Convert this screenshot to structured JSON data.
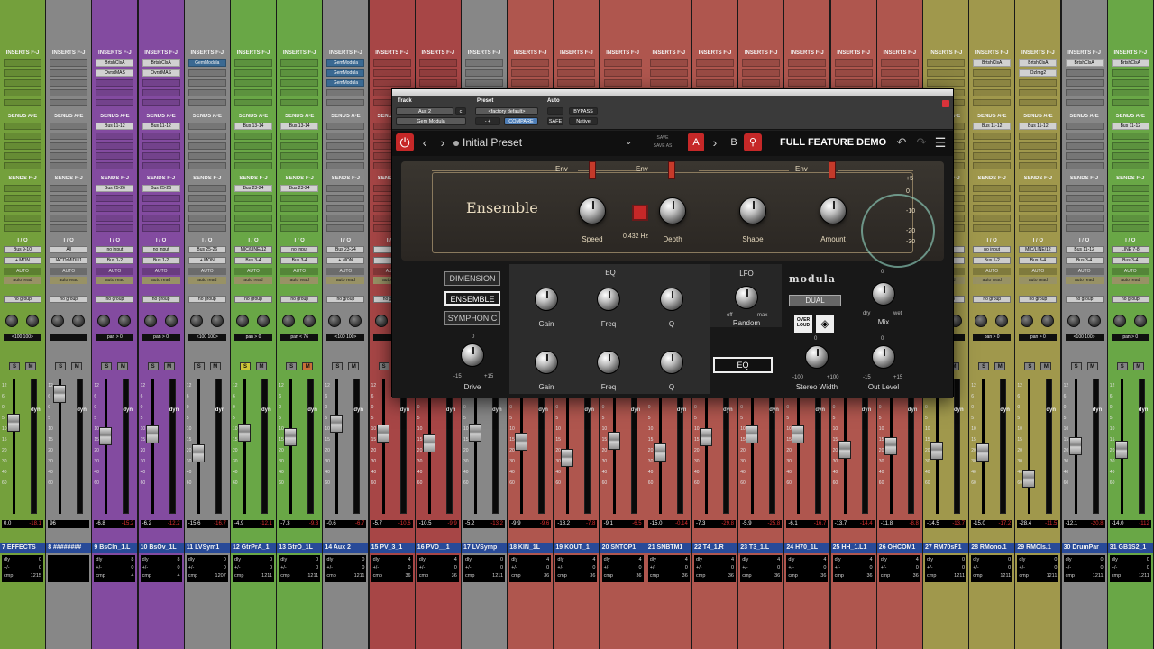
{
  "mixer": {
    "labels": {
      "inserts": "INSERTS F-J",
      "sends_ae": "SENDS A-E",
      "sends_fj": "SENDS F-J",
      "io": "I / O",
      "auto": "AUTO",
      "auto_read": "auto read",
      "group": "no group",
      "mon": "+ MON",
      "dyn": "dyn"
    },
    "strips": [
      {
        "name": "7 EFFECTS",
        "color": "#7aa83f",
        "io_in": "Bus 9-10",
        "io_out": "+ MON",
        "pan": "<100  100>",
        "vol": "0.0",
        "peak": "-18.1",
        "inserts": [],
        "sends": [],
        "sends_b": [],
        "dly": [
          "dly",
          "0"
        ],
        "pm": [
          "+/-",
          "0"
        ],
        "cmp": [
          "cmp",
          "1215"
        ],
        "mute": false,
        "solo": false
      },
      {
        "name": "8 ########",
        "color": "#8e8e8e",
        "io_in": "All",
        "io_out": "IACDrMIDI11",
        "pan": "",
        "vol": "96",
        "peak": "",
        "inserts": [],
        "sends": [],
        "sends_b": [],
        "dly": [
          "",
          ""
        ],
        "pm": [
          "",
          ""
        ],
        "cmp": [
          "",
          ""
        ],
        "mute": false,
        "solo": false
      },
      {
        "name": "9 BsCln_1.L",
        "color": "#8a4fa8",
        "io_in": "no input",
        "io_out": "Bus 1-2",
        "pan": "pan  > 0",
        "vol": "-6.8",
        "peak": "-15.2",
        "inserts": [
          "BrtshClsA",
          "OvrstMAS"
        ],
        "sends": [
          "Bus 11-12"
        ],
        "sends_b": [
          "Bus 25-26"
        ],
        "dly": [
          "dly",
          "8"
        ],
        "pm": [
          "+/-",
          "0"
        ],
        "cmp": [
          "cmp",
          "4"
        ],
        "mute": false,
        "solo": false
      },
      {
        "name": "10 BsOv_1L",
        "color": "#8a4fa8",
        "io_in": "no input",
        "io_out": "Bus 1-2",
        "pan": "pan  > 0",
        "vol": "-6.2",
        "peak": "-12.2",
        "inserts": [
          "BrtshClsA",
          "OvrstMAS"
        ],
        "sends": [
          "Bus 11-12"
        ],
        "sends_b": [
          "Bus 25-26"
        ],
        "dly": [
          "dly",
          "8"
        ],
        "pm": [
          "+/-",
          "0"
        ],
        "cmp": [
          "cmp",
          "4"
        ],
        "mute": false,
        "solo": false
      },
      {
        "name": "11 LVSym1",
        "color": "#8e8e8e",
        "io_in": "Bus 25-26",
        "io_out": "+ MON",
        "pan": "<100  100>",
        "vol": "-15.6",
        "peak": "-16.7",
        "inserts": [
          "GemModula"
        ],
        "sends": [],
        "sends_b": [],
        "dly": [
          "dly",
          "0"
        ],
        "pm": [
          "+/-",
          "0"
        ],
        "cmp": [
          "cmp",
          "1207"
        ],
        "mute": false,
        "solo": false
      },
      {
        "name": "12 GtrPrA_1",
        "color": "#6fb04a",
        "io_in": "MIC/LINE/12",
        "io_out": "Bus 3-4",
        "pan": "pan  > 0",
        "vol": "-4.9",
        "peak": "-12.1",
        "inserts": [],
        "sends": [
          "Bus 13-14"
        ],
        "sends_b": [
          "Bus 23-24"
        ],
        "dly": [
          "dly",
          "0"
        ],
        "pm": [
          "+/-",
          "0"
        ],
        "cmp": [
          "cmp",
          "1211"
        ],
        "mute": false,
        "solo": true
      },
      {
        "name": "13 GtrO_1L",
        "color": "#6fb04a",
        "io_in": "no input",
        "io_out": "Bus 3-4",
        "pan": "pan  < 76",
        "vol": "-7.3",
        "peak": "-9.3",
        "inserts": [],
        "sends": [
          "Bus 13-14"
        ],
        "sends_b": [
          "Bus 23-24"
        ],
        "dly": [
          "dly",
          "0"
        ],
        "pm": [
          "+/-",
          "0"
        ],
        "cmp": [
          "cmp",
          "1211"
        ],
        "mute": true,
        "solo": false
      },
      {
        "name": "14 Aux 2",
        "color": "#8e8e8e",
        "io_in": "Bus 23-24",
        "io_out": "+ MON",
        "pan": "<100  100>",
        "vol": "-0.6",
        "peak": "-6.7",
        "inserts": [
          "GemModula",
          "GemModula",
          "GemModula"
        ],
        "sends": [],
        "sends_b": [],
        "dly": [
          "dly",
          "0"
        ],
        "pm": [
          "+/-",
          "0"
        ],
        "cmp": [
          "cmp",
          "1211"
        ],
        "mute": false,
        "solo": false
      },
      {
        "name": "15 PV_3_1",
        "color": "#b04a4a",
        "io_in": "",
        "io_out": "",
        "pan": "",
        "vol": "-5.7",
        "peak": "-10.6",
        "inserts": [],
        "sends": [],
        "sends_b": [],
        "dly": [
          "dly",
          "4"
        ],
        "pm": [
          "+/-",
          "0"
        ],
        "cmp": [
          "cmp",
          "36"
        ],
        "mute": false,
        "solo": false
      },
      {
        "name": "16 PVD__1",
        "color": "#b04a4a",
        "io_in": "",
        "io_out": "",
        "pan": "",
        "vol": "-10.5",
        "peak": "-9.9",
        "inserts": [],
        "sends": [],
        "sends_b": [],
        "dly": [
          "dly",
          "4"
        ],
        "pm": [
          "+/-",
          "0"
        ],
        "cmp": [
          "cmp",
          "36"
        ],
        "mute": false,
        "solo": false
      },
      {
        "name": "17 LVSymp",
        "color": "#8e8e8e",
        "io_in": "",
        "io_out": "",
        "pan": "",
        "vol": "-5.2",
        "peak": "-13.2",
        "inserts": [],
        "sends": [],
        "sends_b": [],
        "dly": [
          "dly",
          "0"
        ],
        "pm": [
          "+/-",
          "0"
        ],
        "cmp": [
          "cmp",
          "1211"
        ],
        "mute": false,
        "solo": false
      },
      {
        "name": "18 KIN_1L",
        "color": "#b85a52",
        "io_in": "",
        "io_out": "",
        "pan": "",
        "vol": "-9.9",
        "peak": "-9.6",
        "inserts": [],
        "sends": [],
        "sends_b": [],
        "dly": [
          "dly",
          "4"
        ],
        "pm": [
          "+/-",
          "0"
        ],
        "cmp": [
          "cmp",
          "36"
        ],
        "mute": false,
        "solo": false
      },
      {
        "name": "19 KOUT_1",
        "color": "#b85a52",
        "io_in": "",
        "io_out": "",
        "pan": "",
        "vol": "-18.2",
        "peak": "-7.8",
        "inserts": [],
        "sends": [],
        "sends_b": [],
        "dly": [
          "dly",
          "4"
        ],
        "pm": [
          "+/-",
          "0"
        ],
        "cmp": [
          "cmp",
          "36"
        ],
        "mute": false,
        "solo": false
      },
      {
        "name": "20 SNTOP1",
        "color": "#b85a52",
        "io_in": "",
        "io_out": "",
        "pan": "",
        "vol": "-9.1",
        "peak": "-6.5",
        "inserts": [],
        "sends": [],
        "sends_b": [],
        "dly": [
          "dly",
          "4"
        ],
        "pm": [
          "+/-",
          "0"
        ],
        "cmp": [
          "cmp",
          "36"
        ],
        "mute": false,
        "solo": false
      },
      {
        "name": "21 SNBTM1",
        "color": "#b85a52",
        "io_in": "",
        "io_out": "",
        "pan": "",
        "vol": "-15.0",
        "peak": "-0.14",
        "inserts": [],
        "sends": [],
        "sends_b": [],
        "dly": [
          "dly",
          "4"
        ],
        "pm": [
          "+/-",
          "0"
        ],
        "cmp": [
          "cmp",
          "36"
        ],
        "mute": false,
        "solo": false
      },
      {
        "name": "22 T4_1.R",
        "color": "#b85a52",
        "io_in": "",
        "io_out": "",
        "pan": "",
        "vol": "-7.3",
        "peak": "-29.8",
        "inserts": [],
        "sends": [],
        "sends_b": [],
        "dly": [
          "dly",
          "4"
        ],
        "pm": [
          "+/-",
          "0"
        ],
        "cmp": [
          "cmp",
          "36"
        ],
        "mute": false,
        "solo": false
      },
      {
        "name": "23 T3_1.L",
        "color": "#b85a52",
        "io_in": "",
        "io_out": "",
        "pan": "",
        "vol": "-5.9",
        "peak": "-25.8",
        "inserts": [],
        "sends": [],
        "sends_b": [],
        "dly": [
          "dly",
          "4"
        ],
        "pm": [
          "+/-",
          "0"
        ],
        "cmp": [
          "cmp",
          "36"
        ],
        "mute": false,
        "solo": false
      },
      {
        "name": "24 H70_1L",
        "color": "#b85a52",
        "io_in": "",
        "io_out": "",
        "pan": "",
        "vol": "-6.1",
        "peak": "-16.7",
        "inserts": [],
        "sends": [],
        "sends_b": [],
        "dly": [
          "dly",
          "4"
        ],
        "pm": [
          "+/-",
          "0"
        ],
        "cmp": [
          "cmp",
          "36"
        ],
        "mute": false,
        "solo": false
      },
      {
        "name": "25 HH_1.L1",
        "color": "#b85a52",
        "io_in": "",
        "io_out": "",
        "pan": "",
        "vol": "-13.7",
        "peak": "-14.4",
        "inserts": [],
        "sends": [],
        "sends_b": [],
        "dly": [
          "dly",
          "4"
        ],
        "pm": [
          "+/-",
          "0"
        ],
        "cmp": [
          "cmp",
          "36"
        ],
        "mute": false,
        "solo": false
      },
      {
        "name": "26 OHCOM1",
        "color": "#b85a52",
        "io_in": "",
        "io_out": "",
        "pan": "",
        "vol": "-11.8",
        "peak": "-8.8",
        "inserts": [],
        "sends": [],
        "sends_b": [],
        "dly": [
          "dly",
          "4"
        ],
        "pm": [
          "+/-",
          "0"
        ],
        "cmp": [
          "cmp",
          "36"
        ],
        "mute": false,
        "solo": false
      },
      {
        "name": "27 RM70sF1",
        "color": "#a8a050",
        "io_in": "",
        "io_out": "",
        "pan": "",
        "vol": "-14.5",
        "peak": "-13.7",
        "inserts": [],
        "sends": [],
        "sends_b": [],
        "dly": [
          "dly",
          "0"
        ],
        "pm": [
          "+/-",
          "0"
        ],
        "cmp": [
          "cmp",
          "1211"
        ],
        "mute": false,
        "solo": false
      },
      {
        "name": "28 RMono.1",
        "color": "#a8a050",
        "io_in": "no input",
        "io_out": "Bus 1-2",
        "pan": "pan  > 0",
        "vol": "-15.0",
        "peak": "-17.2",
        "inserts": [
          "BrtshClsA"
        ],
        "sends": [
          "Bus 11-12"
        ],
        "sends_b": [],
        "dly": [
          "dly",
          "0"
        ],
        "pm": [
          "+/-",
          "0"
        ],
        "cmp": [
          "cmp",
          "1211"
        ],
        "mute": false,
        "solo": false
      },
      {
        "name": "29 RMCls.1",
        "color": "#a8a050",
        "io_in": "MIC/LINE/12",
        "io_out": "Bus 3-4",
        "pan": "pan  > 0",
        "vol": "-28.4",
        "peak": "-11.5",
        "inserts": [
          "BrtshClsA",
          "OzImg2"
        ],
        "sends": [
          "Bus 11-12"
        ],
        "sends_b": [],
        "dly": [
          "dly",
          "0"
        ],
        "pm": [
          "+/-",
          "0"
        ],
        "cmp": [
          "cmp",
          "1211"
        ],
        "mute": false,
        "solo": false
      },
      {
        "name": "30 DrumPar",
        "color": "#8e8e8e",
        "io_in": "Bus 11-12",
        "io_out": "Bus 3-4",
        "pan": "<100  100>",
        "vol": "-12.1",
        "peak": "-20.8",
        "inserts": [
          "BrtshClsA"
        ],
        "sends": [],
        "sends_b": [],
        "dly": [
          "dly",
          "0"
        ],
        "pm": [
          "+/-",
          "0"
        ],
        "cmp": [
          "cmp",
          "1211"
        ],
        "mute": false,
        "solo": false
      },
      {
        "name": "31 GB1S2_1",
        "color": "#6fb04a",
        "io_in": "LINE 7-8",
        "io_out": "Bus 3-4",
        "pan": "pan  > 0",
        "vol": "-14.0",
        "peak": "-112",
        "inserts": [
          "BrtshClsA"
        ],
        "sends": [
          "Bus 11-12"
        ],
        "sends_b": [],
        "dly": [
          "dly",
          "0"
        ],
        "pm": [
          "+/-",
          "0"
        ],
        "cmp": [
          "cmp",
          "1211"
        ],
        "mute": false,
        "solo": false
      }
    ]
  },
  "plugin": {
    "header": {
      "track_label": "Track",
      "preset_label": "Preset",
      "auto_label": "Auto",
      "track_value": "Aux 2",
      "track_suffix": "c",
      "insert_name": "Gem Modula",
      "preset_value": "<factory default>",
      "compare": "COMPARE",
      "bypass": "BYPASS",
      "safe": "SAFE",
      "native": "Native",
      "plus_minus": "-  +"
    },
    "toolbar": {
      "preset_name": "Initial Preset",
      "save": "SAVE",
      "save_as": "SAVE AS",
      "a": "A",
      "b": "B",
      "title": "FULL FEATURE DEMO"
    },
    "upper": {
      "mode_name": "Ensemble",
      "env": "Env",
      "speed": "Speed",
      "depth": "Depth",
      "shape": "Shape",
      "amount": "Amount",
      "rate": "0.432 Hz",
      "meter_scale": [
        "+5",
        "0",
        "-10",
        "-20",
        "-30"
      ]
    },
    "lower": {
      "modes": [
        "DIMENSION",
        "ENSEMBLE",
        "SYMPHONIC"
      ],
      "active_mode": "ENSEMBLE",
      "eq": "EQ",
      "gain": "Gain",
      "freq": "Freq",
      "q": "Q",
      "lfo": "LFO",
      "random": "Random",
      "off": "off",
      "max": "max",
      "drive": "Drive",
      "drive_min": "-15",
      "drive_max": "+15",
      "zero": "0",
      "eq_button": "EQ",
      "brand": "modula",
      "dual": "DUAL",
      "overloud": "OVER LOUD",
      "mix": "Mix",
      "dry": "dry",
      "wet": "wet",
      "stereo_width": "Stereo Width",
      "sw_min": "-100",
      "sw_max": "+100",
      "out_level": "Out Level",
      "ol_min": "-15",
      "ol_max": "+15"
    }
  }
}
